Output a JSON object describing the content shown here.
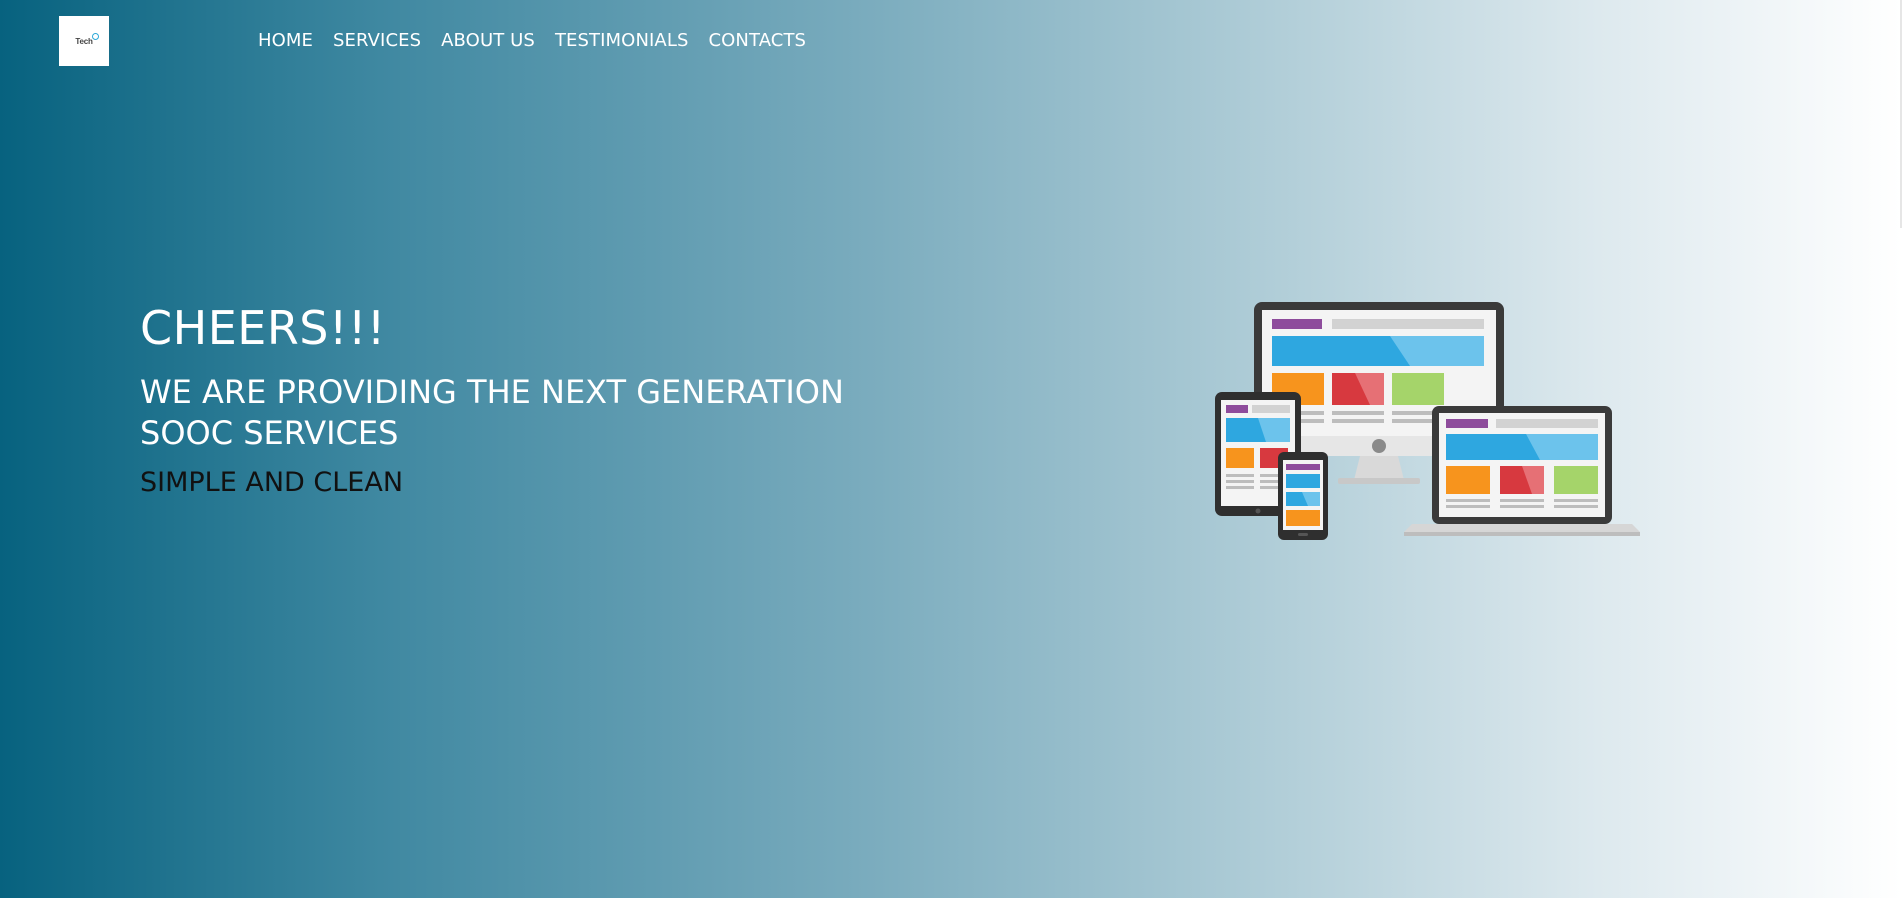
{
  "logo": {
    "text": "Tech",
    "icon": "tech-logo"
  },
  "nav": {
    "items": [
      {
        "label": "HOME"
      },
      {
        "label": "SERVICES"
      },
      {
        "label": "ABOUT US"
      },
      {
        "label": "TESTIMONIALS"
      },
      {
        "label": "CONTACTS"
      }
    ]
  },
  "hero": {
    "title": "CHEERS!!!",
    "subtitle": "WE ARE PROVIDING THE NEXT GENERATION SOOC SERVICES",
    "tagline": "SIMPLE AND CLEAN",
    "illustration": "responsive-devices-icon"
  },
  "colors": {
    "gradient_start": "#07627f",
    "gradient_end": "#ffffff",
    "device_blue": "#2ea7e0",
    "device_orange": "#f7941d",
    "device_red": "#d7393f",
    "device_green": "#a5d46a",
    "device_purple": "#8e4c9c"
  }
}
